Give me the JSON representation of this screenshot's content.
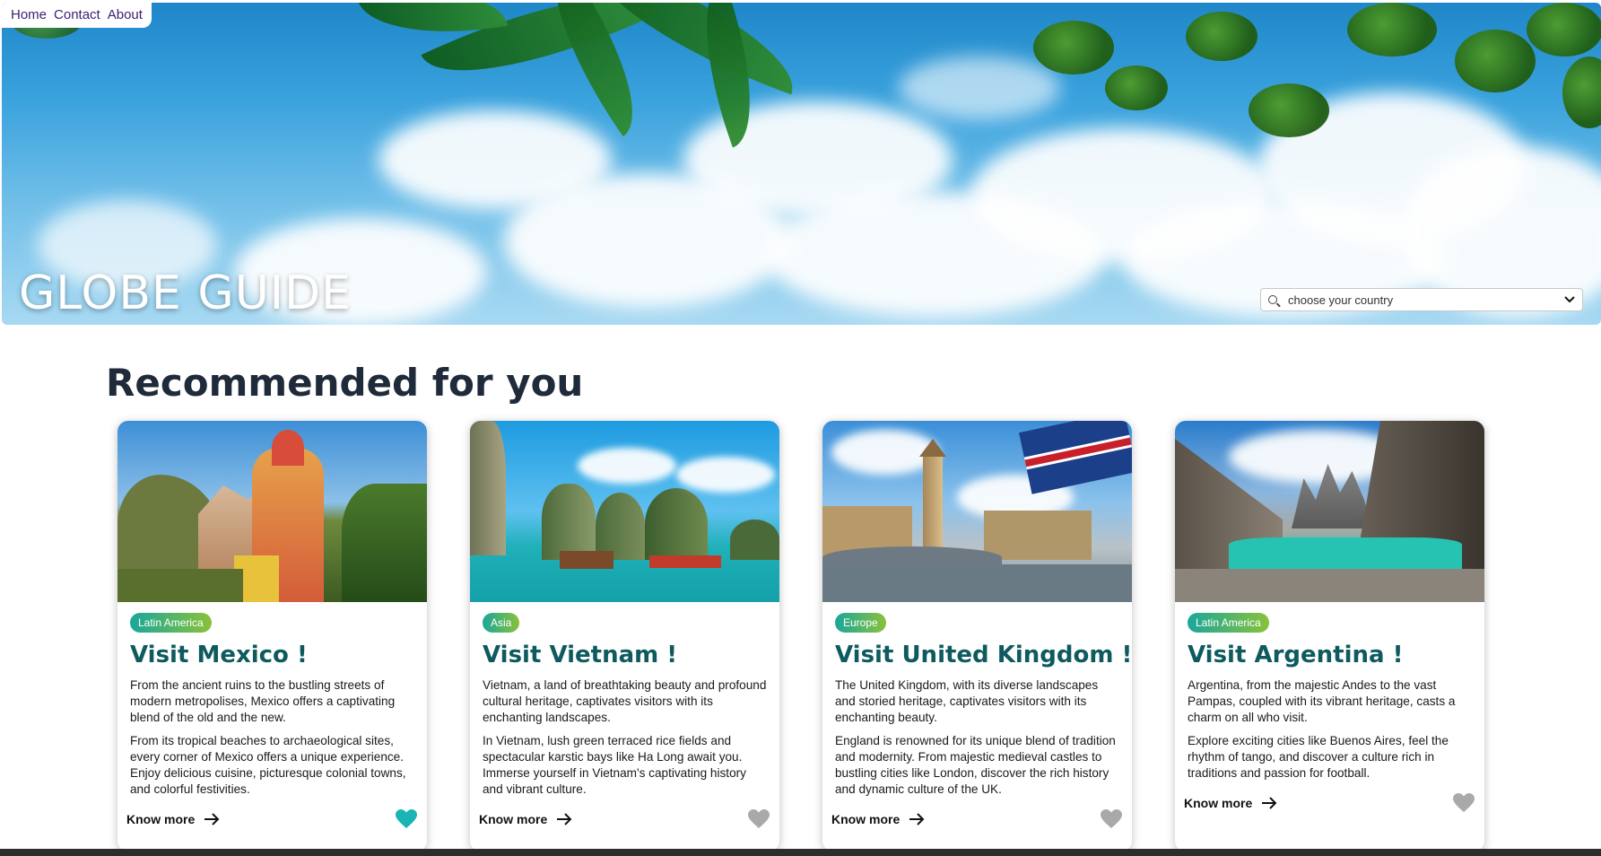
{
  "nav": {
    "links": [
      "Home",
      "Contact",
      "About"
    ]
  },
  "hero": {
    "brand": "GLOBE GUIDE",
    "select_placeholder": "choose your country"
  },
  "section": {
    "title": "Recommended for you"
  },
  "cards": [
    {
      "region": "Latin America",
      "title": "Visit Mexico !",
      "paragraphs": [
        "From the ancient ruins to the bustling streets of modern metropolises, Mexico offers a captivating blend of the old and the new.",
        "From its tropical beaches to archaeological sites, every corner of Mexico offers a unique experience. Enjoy delicious cuisine, picturesque colonial towns, and colorful festivities."
      ],
      "cta": "Know more",
      "favorited": true
    },
    {
      "region": "Asia",
      "title": "Visit Vietnam !",
      "paragraphs": [
        "Vietnam, a land of breathtaking beauty and profound cultural heritage, captivates visitors with its enchanting landscapes.",
        "In Vietnam, lush green terraced rice fields and spectacular karstic bays like Ha Long await you. Immerse yourself in Vietnam's captivating history and vibrant culture."
      ],
      "cta": "Know more",
      "favorited": false
    },
    {
      "region": "Europe",
      "title": "Visit United Kingdom !",
      "paragraphs": [
        "The United Kingdom, with its diverse landscapes and storied heritage, captivates visitors with its enchanting beauty.",
        "England is renowned for its unique blend of tradition and modernity. From majestic medieval castles to bustling cities like London, discover the rich history and dynamic culture of the UK."
      ],
      "cta": "Know more",
      "favorited": false
    },
    {
      "region": "Latin America",
      "title": "Visit Argentina !",
      "paragraphs": [
        "Argentina, from the majestic Andes to the vast Pampas, coupled with its vibrant heritage, casts a charm on all who visit.",
        "Explore exciting cities like Buenos Aires, feel the rhythm of tango, and discover a culture rich in traditions and passion for football."
      ],
      "cta": "Know more",
      "favorited": false
    }
  ],
  "colors": {
    "accent_teal": "#0e5a5f",
    "heart_active": "#1ab4b4",
    "heart_inactive": "#a9a9a9",
    "nav_link": "#3b1f73",
    "badge_gradient_start": "#1aa79a",
    "badge_gradient_end": "#8ac13a"
  },
  "icons": {
    "select": "search-icon",
    "select_toggle": "chevron-down-icon",
    "cta": "arrow-right-icon",
    "favorite": "heart-icon"
  }
}
